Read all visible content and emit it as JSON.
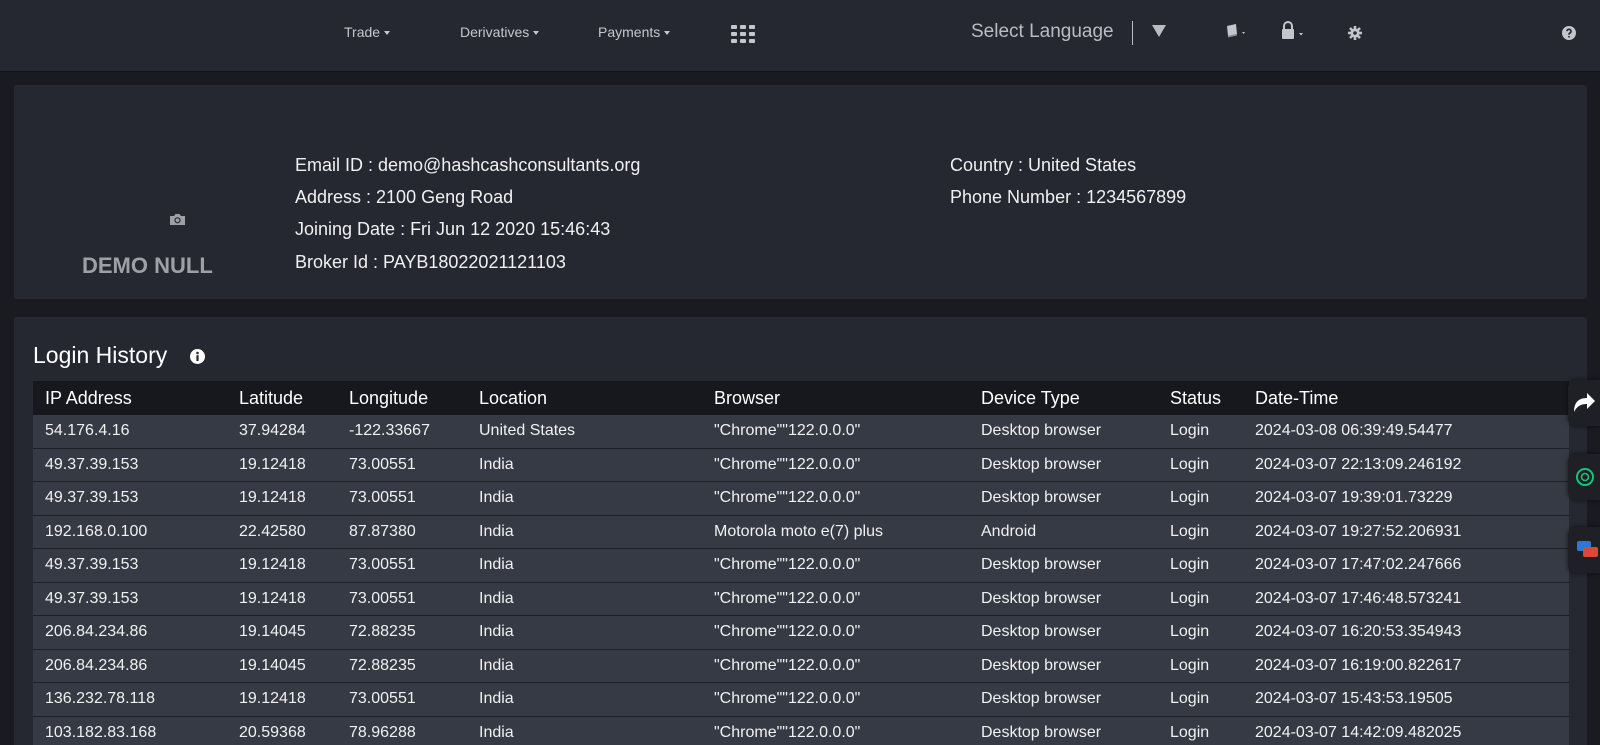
{
  "nav": {
    "trade": "Trade",
    "derivatives": "Derivatives",
    "payments": "Payments",
    "apps_icon": "grid-icon",
    "language": "Select Language",
    "book_icon": "book-icon",
    "lock_icon": "lock-icon",
    "settings_icon": "gear-icon",
    "help_icon": "help-icon"
  },
  "profile": {
    "name": "DEMO NULL",
    "camera_icon": "camera-icon",
    "email": "Email ID : demo@hashcashconsultants.org",
    "address": "Address : 2100 Geng Road",
    "joining_date": "Joining Date : Fri Jun 12 2020 15:46:43",
    "broker_id": "Broker Id : PAYB18022021121103",
    "country": "Country : United States",
    "phone": "Phone Number : 1234567899"
  },
  "login_history": {
    "title": "Login History",
    "columns": [
      "IP Address",
      "Latitude",
      "Longitude",
      "Location",
      "Browser",
      "Device Type",
      "Status",
      "Date-Time"
    ],
    "rows": [
      [
        "54.176.4.16",
        "37.94284",
        "-122.33667",
        "United States",
        "\"Chrome\"\"122.0.0.0\"",
        "Desktop browser",
        "Login",
        "2024-03-08 06:39:49.54477"
      ],
      [
        "49.37.39.153",
        "19.12418",
        "73.00551",
        "India",
        "\"Chrome\"\"122.0.0.0\"",
        "Desktop browser",
        "Login",
        "2024-03-07 22:13:09.246192"
      ],
      [
        "49.37.39.153",
        "19.12418",
        "73.00551",
        "India",
        "\"Chrome\"\"122.0.0.0\"",
        "Desktop browser",
        "Login",
        "2024-03-07 19:39:01.73229"
      ],
      [
        "192.168.0.100",
        "22.42580",
        "87.87380",
        "India",
        "Motorola moto e(7) plus",
        "Android",
        "Login",
        "2024-03-07 19:27:52.206931"
      ],
      [
        "49.37.39.153",
        "19.12418",
        "73.00551",
        "India",
        "\"Chrome\"\"122.0.0.0\"",
        "Desktop browser",
        "Login",
        "2024-03-07 17:47:02.247666"
      ],
      [
        "49.37.39.153",
        "19.12418",
        "73.00551",
        "India",
        "\"Chrome\"\"122.0.0.0\"",
        "Desktop browser",
        "Login",
        "2024-03-07 17:46:48.573241"
      ],
      [
        "206.84.234.86",
        "19.14045",
        "72.88235",
        "India",
        "\"Chrome\"\"122.0.0.0\"",
        "Desktop browser",
        "Login",
        "2024-03-07 16:20:53.354943"
      ],
      [
        "206.84.234.86",
        "19.14045",
        "72.88235",
        "India",
        "\"Chrome\"\"122.0.0.0\"",
        "Desktop browser",
        "Login",
        "2024-03-07 16:19:00.822617"
      ],
      [
        "136.232.78.118",
        "19.12418",
        "73.00551",
        "India",
        "\"Chrome\"\"122.0.0.0\"",
        "Desktop browser",
        "Login",
        "2024-03-07 15:43:53.19505"
      ],
      [
        "103.182.83.168",
        "20.59368",
        "78.96288",
        "India",
        "\"Chrome\"\"122.0.0.0\"",
        "Desktop browser",
        "Login",
        "2024-03-07 14:42:09.482025"
      ]
    ]
  },
  "side_tabs": [
    "share-icon",
    "chatgpt-icon",
    "chat-bubbles-icon"
  ]
}
